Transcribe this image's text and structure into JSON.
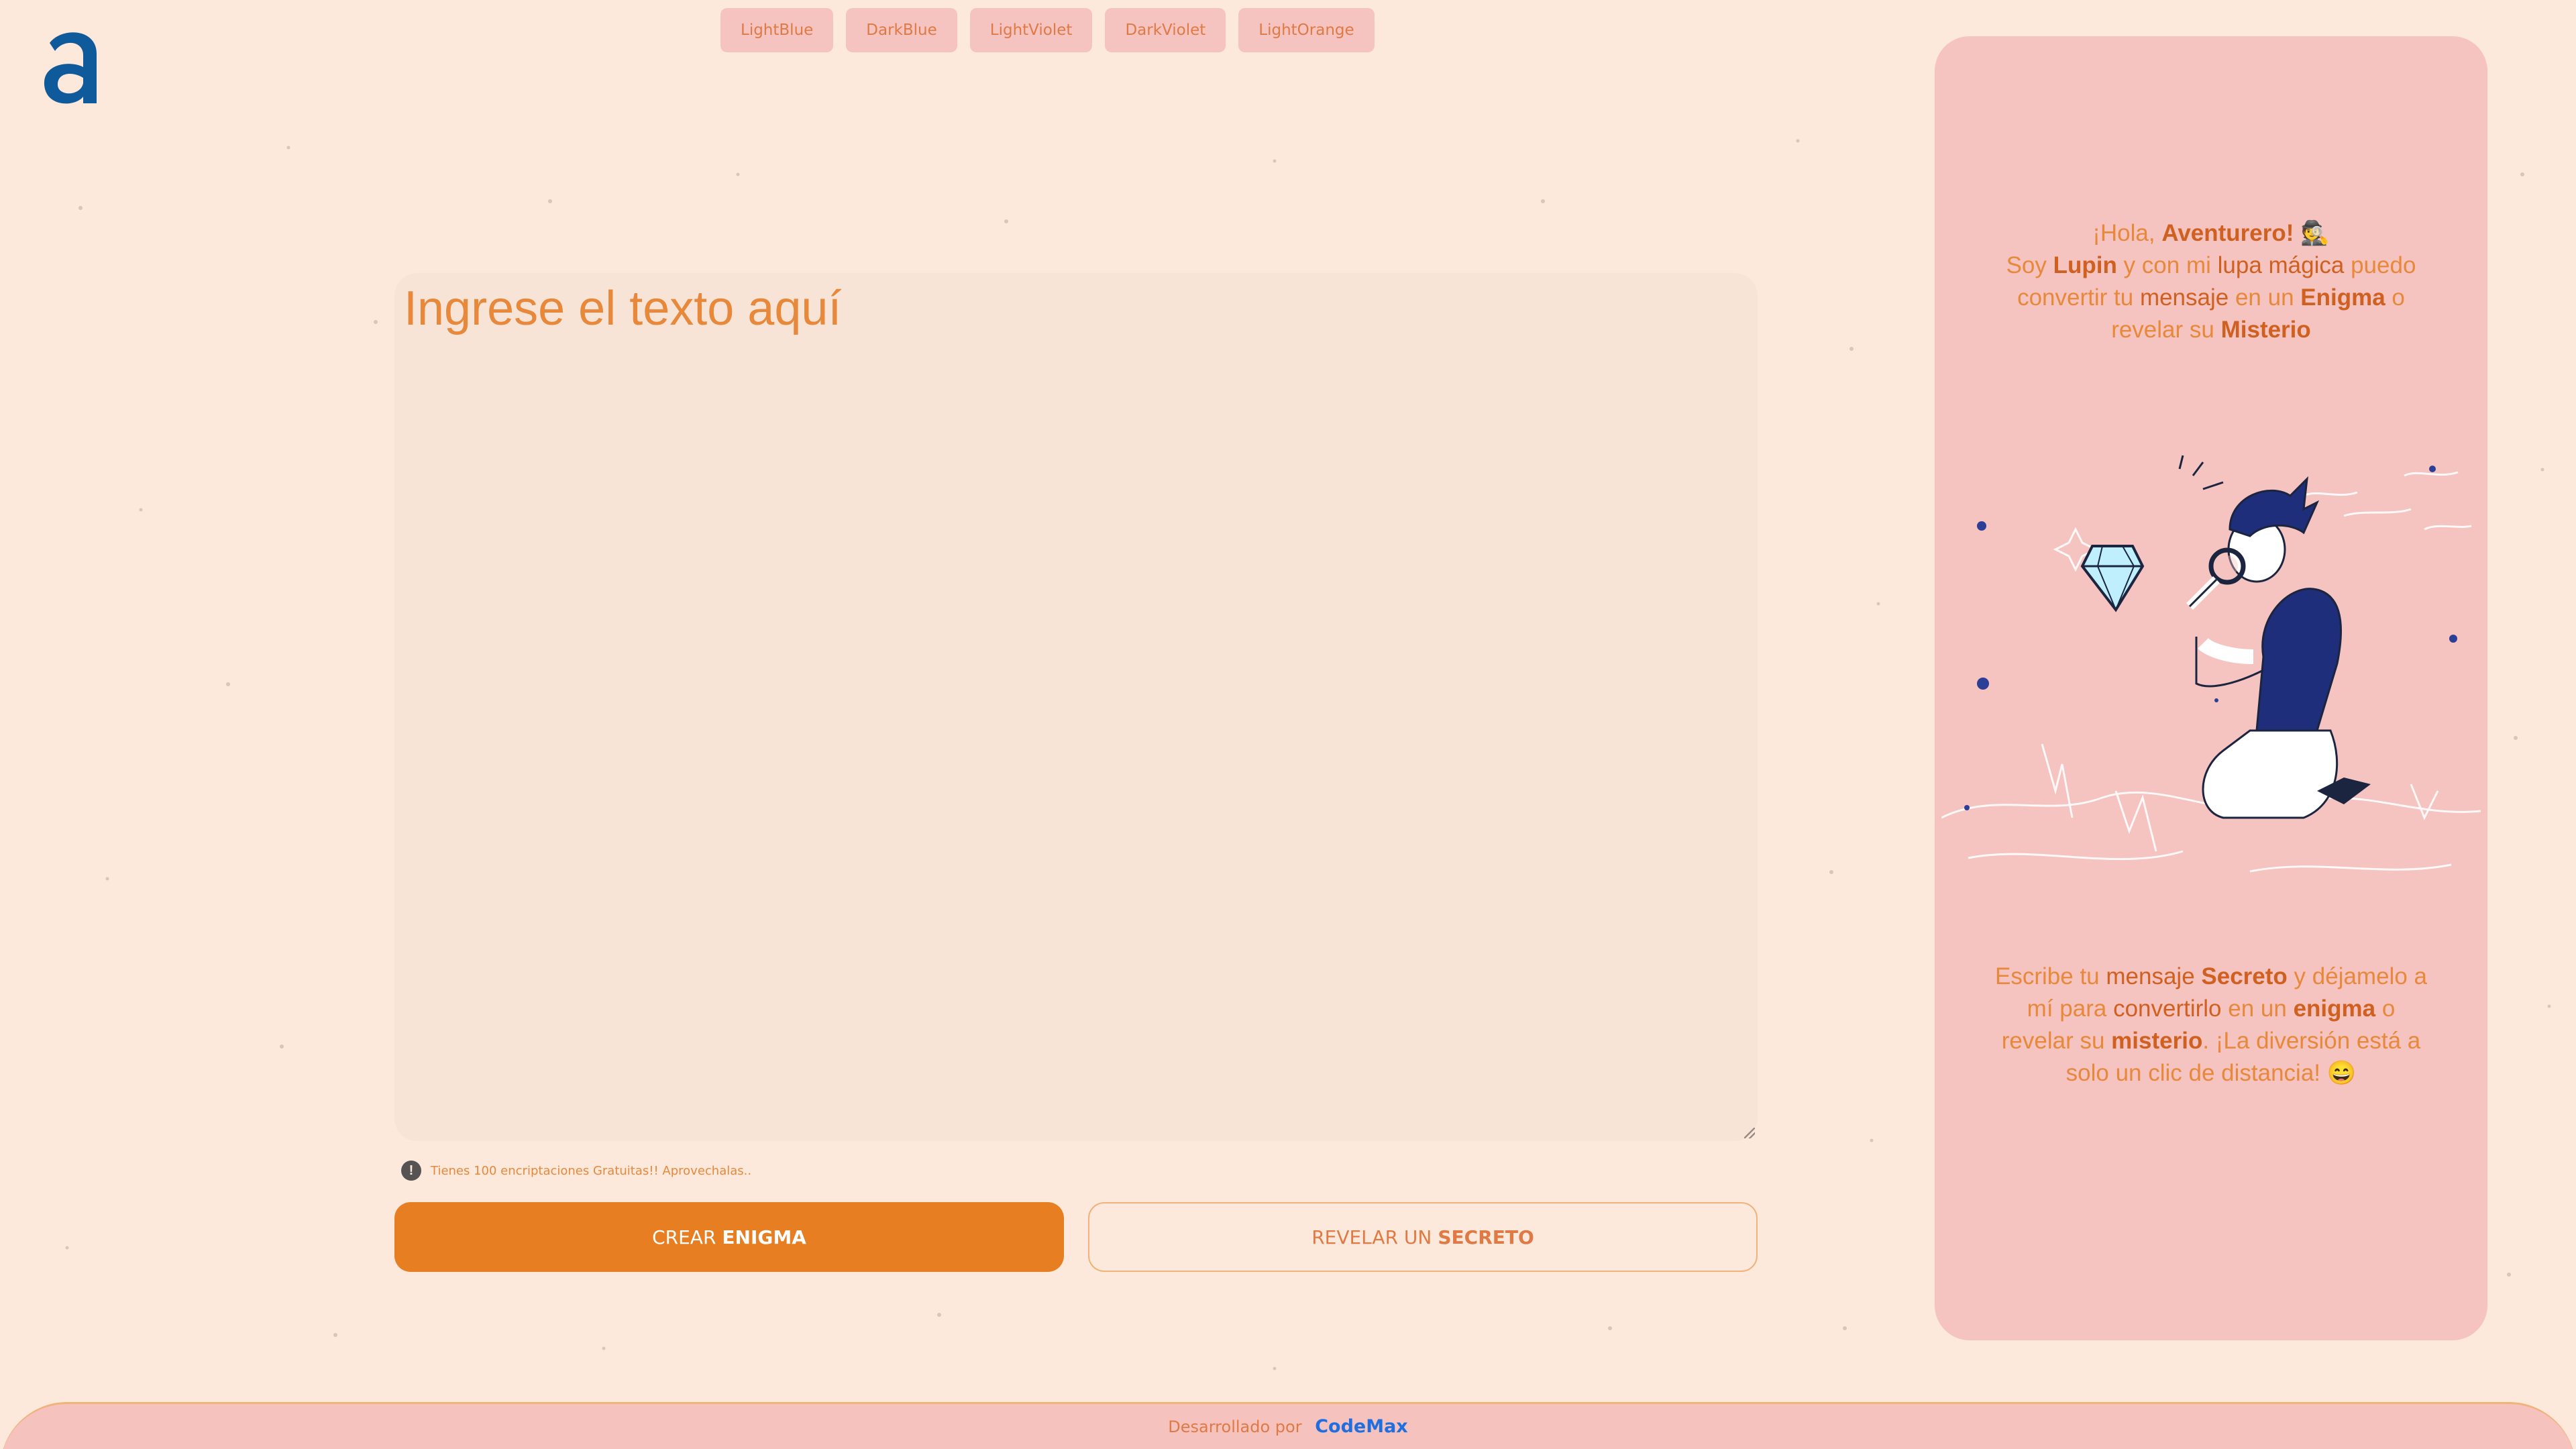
{
  "logo": {
    "glyph": "a",
    "color": "#0e5a9a"
  },
  "themes": [
    "LightBlue",
    "DarkBlue",
    "LightViolet",
    "DarkViolet",
    "LightOrange"
  ],
  "input": {
    "placeholder": "Ingrese el texto aquí"
  },
  "notice": {
    "icon": "!",
    "text": "Tienes 100 encriptaciones Gratuitas!! Aprovechalas.."
  },
  "actions": {
    "create": {
      "prefix": "CREAR",
      "strong": "ENIGMA"
    },
    "reveal": {
      "prefix": "REVELAR UN",
      "strong": "SECRETO"
    }
  },
  "card": {
    "intro": {
      "p1": "¡Hola, ",
      "b1": "Aventurero!",
      "emoji1": " 🕵️",
      "p2": "Soy ",
      "b2": "Lupin",
      "p3": " y con mi ",
      "p4": "lupa mágica",
      "p5": " puedo convertir tu ",
      "p6": "mensaje",
      "p7": " en un ",
      "b3": "Enigma",
      "p8": " o revelar su ",
      "b4": "Misterio"
    },
    "outro": {
      "p1": "Escribe tu ",
      "p2": "mensaje",
      "p3": " ",
      "b1": "Secreto",
      "p4": " y déjamelo a mí para ",
      "p5": "convertirlo",
      "p6": " en un ",
      "b2": "enigma",
      "p7": " o revelar su ",
      "b3": "misterio",
      "p8": ". ¡La diversión está a solo un clic de distancia! ",
      "emoji": "😄"
    }
  },
  "footer": {
    "label": "Desarrollado por",
    "link": "CodeMax"
  },
  "colors": {
    "background": "#fde9db",
    "accent": "#e77e22",
    "card": "#f5c3c0",
    "link": "#1f6fe0"
  }
}
